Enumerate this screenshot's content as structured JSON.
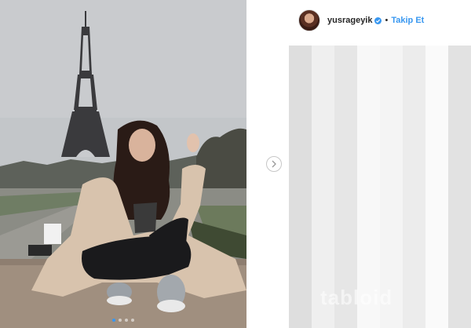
{
  "post": {
    "username": "yusrageyik",
    "separator": "•",
    "follow_label": "Takip Et",
    "verified": true,
    "carousel": {
      "dot_count": 4,
      "active_index": 0
    },
    "colors": {
      "accent": "#3897f0",
      "username": "#262626"
    },
    "icons": {
      "verified": "verified-badge-icon",
      "next": "chevron-right-icon"
    },
    "watermark": "tabloid"
  }
}
